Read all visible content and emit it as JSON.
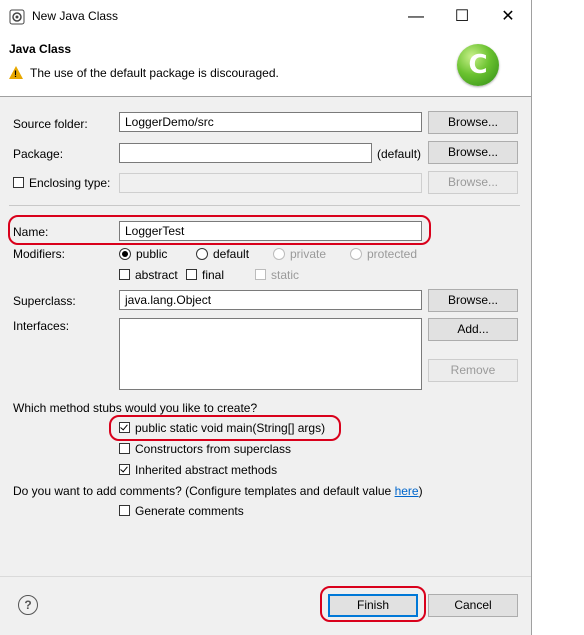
{
  "window": {
    "title": "New Java Class",
    "minimize": "—",
    "maximize": "☐",
    "close": "✕"
  },
  "header": {
    "title": "Java Class",
    "warning": "The use of the default package is discouraged.",
    "icon_letter": "C"
  },
  "form": {
    "source_folder_label": "Source folder:",
    "source_folder_value": "LoggerDemo/src",
    "package_label": "Package:",
    "package_value": "",
    "package_hint": "(default)",
    "enclosing_label": "Enclosing type:",
    "enclosing_value": "",
    "browse_label": "Browse...",
    "name_label": "Name:",
    "name_value": "LoggerTest",
    "modifiers_label": "Modifiers:",
    "modifiers": {
      "public": "public",
      "default": "default",
      "private": "private",
      "protected": "protected",
      "abstract": "abstract",
      "final": "final",
      "static": "static"
    },
    "superclass_label": "Superclass:",
    "superclass_value": "java.lang.Object",
    "interfaces_label": "Interfaces:",
    "add_label": "Add...",
    "remove_label": "Remove",
    "stubs_question": "Which method stubs would you like to create?",
    "stub_main": "public static void main(String[] args)",
    "stub_constructors": "Constructors from superclass",
    "stub_inherited": "Inherited abstract methods",
    "comments_question": "Do you want to add comments? (Configure templates and default value ",
    "comments_link": "here",
    "comments_end": ")",
    "generate_comments": "Generate comments"
  },
  "footer": {
    "help": "?",
    "finish": "Finish",
    "cancel": "Cancel"
  },
  "colors": {
    "highlight": "#d9001b",
    "link": "#0066cc",
    "warning": "#e8a800"
  }
}
